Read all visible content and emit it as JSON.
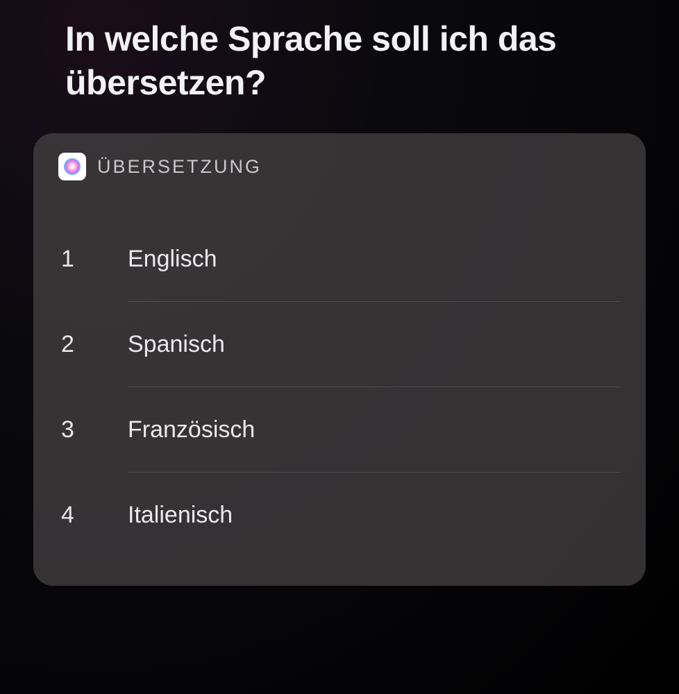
{
  "prompt": {
    "title": "In welche Sprache soll ich das übersetzen?"
  },
  "card": {
    "title": "ÜBERSETZUNG",
    "icon_name": "siri-icon"
  },
  "options": [
    {
      "number": "1",
      "label": "Englisch"
    },
    {
      "number": "2",
      "label": "Spanisch"
    },
    {
      "number": "3",
      "label": "Französisch"
    },
    {
      "number": "4",
      "label": "Italienisch"
    }
  ]
}
